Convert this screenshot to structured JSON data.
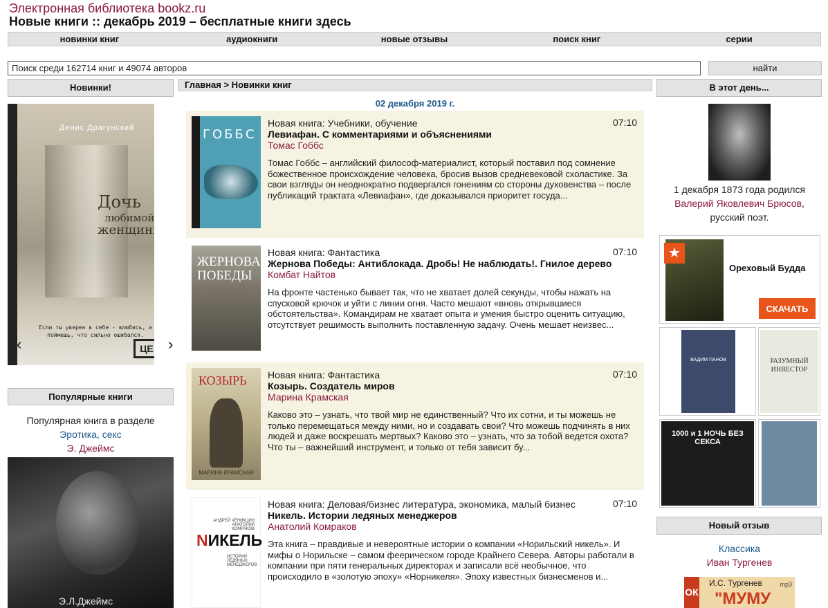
{
  "site": {
    "title": "Электронная библиотека bookz.ru",
    "heading": "Новые книги :: декабрь 2019 – бесплатные книги здесь"
  },
  "nav": [
    "новинки книг",
    "аудиокниги",
    "новые отзывы",
    "поиск книг",
    "серии"
  ],
  "search": {
    "value": "Поиск среди 162714 книг и 49074 авторов",
    "button": "найти"
  },
  "left": {
    "new_header": "Новинки!",
    "slider": {
      "author": "Денис Драгунский",
      "title1": "Дочь",
      "title2": "любимой",
      "title3": "женщины",
      "quote": "Если ты уверен в себе - влюбись, и поймешь, что сильно ошибался.",
      "prev": "‹",
      "next": "›"
    },
    "popular_header": "Популярные книги",
    "popular_line": "Популярная книга в разделе",
    "popular_genre": "Эротика, секс",
    "popular_author": "Э. Джеймс",
    "popular_cover_author": "Э.Л.Джеймс"
  },
  "center": {
    "breadcrumb": "Главная > Новинки книг",
    "date": "02 декабря 2019 г.",
    "books": [
      {
        "genre": "Новая книга: Учебники, обучение",
        "time": "07:10",
        "title": "Левиафан. С комментариями и объяснениями",
        "author": "Томас Гоббс",
        "desc": "Томас Гоббс – английский философ-материалист, который поставил под сомнение божественное происхождение человека, бросив вызов средневековой схоластике. За свои взгляды он неоднократно подвергался гонениям со стороны духовенства – после публикаций трактата «Левиафан», где доказывался приоритет госуда...",
        "cover_text": "ГОББС"
      },
      {
        "genre": "Новая книга: Фантастика",
        "time": "07:10",
        "title": "Жернова Победы: Антиблокада. Дробь! Не наблюдать!. Гнилое дерево",
        "author": "Комбат Найтов",
        "desc": "На фронте частенько бывает так, что не хватает долей секунды, чтобы нажать на спусковой крючок и уйти с линии огня. Часто мешают «вновь открывшиеся обстоятельства». Командирам не хватает опыта и умения быстро оценить ситуацию, отсутствует решимость выполнить поставленную задачу. Очень мешает неизвес...",
        "cover_text": "ЖЕРНОВА ПОБЕДЫ"
      },
      {
        "genre": "Новая книга: Фантастика",
        "time": "07:10",
        "title": "Козырь. Создатель миров",
        "author": "Марина Крамская",
        "desc": "Каково это – узнать, что твой мир не единственный? Что их сотни, и ты можешь не только перемещаться между ними, но и создавать свои? Что можешь подчинять в них людей и даже воскрешать мертвых? Каково это – узнать, что за тобой ведется охота? Что ты – важнейший инструмент, и только от тебя зависит бу...",
        "cover_text": "КОЗЫРЬ",
        "cover_author": "МАРИНА КРАМСКАЯ"
      },
      {
        "genre": "Новая книга: Деловая/бизнес литература, экономика, малый бизнес",
        "time": "07:10",
        "title": "Никель. Истории ледяных менеджеров",
        "author": "Анатолий Комраков",
        "desc": "Эта книга – правдивые и невероятные истории о компании «Норильский никель». И мифы о Норильске – самом феерическом городе Крайнего Севера. Авторы работали в компании при пяти генеральных директорах и записали всё необычное, что происходило в «золотую эпоху» «Норникеля». Эпоху известных бизнесменов и...",
        "cover_text_first": "N",
        "cover_text_rest": "ИКЕЛЬ",
        "cover_authors": "АНДРЕЙ ЧЕНИКЦИН АНАТОЛИЙ КОМРАКОВ",
        "cover_sub": "ИСТОРИИ ЛЕДЯНЫХ МЕНЕДЖЕРОВ"
      }
    ]
  },
  "right": {
    "today_header": "В этот день...",
    "today_line1": "1 декабря 1873 года родился",
    "today_person": "Валерий Яковлевич Брюсов",
    "today_comma": ",",
    "today_line3": "русский поэт.",
    "promo": {
      "title": "Ореховый Будда",
      "button": "СКАЧАТЬ",
      "star": "★"
    },
    "thumbs": [
      {
        "text": "ВАДИМ ПАНОВ",
        "color": "#3d4a6b"
      },
      {
        "text": "РАЗУМНЫЙ ИНВЕСТОР",
        "color": "#e9eadf"
      },
      {
        "text": "1000 и 1 НОЧЬ БЕЗ СЕКСА",
        "color": "#1c1c1c"
      },
      {
        "text": "",
        "color": "#6f8aa0"
      }
    ],
    "review_header": "Новый отзыв",
    "review_genre": "Классика",
    "review_author": "Иван Тургенев",
    "review_cover": {
      "left": "ОК",
      "author": "И.С. Тургенев",
      "title": "\"МУМУ",
      "format": "mp3"
    }
  },
  "colors": {
    "accent_red": "#8b1a3c",
    "link_blue": "#1e5a8c",
    "button_orange": "#e8541a",
    "panel_gray": "#e3e3e3",
    "entry_bg": "#f6f3e2"
  }
}
